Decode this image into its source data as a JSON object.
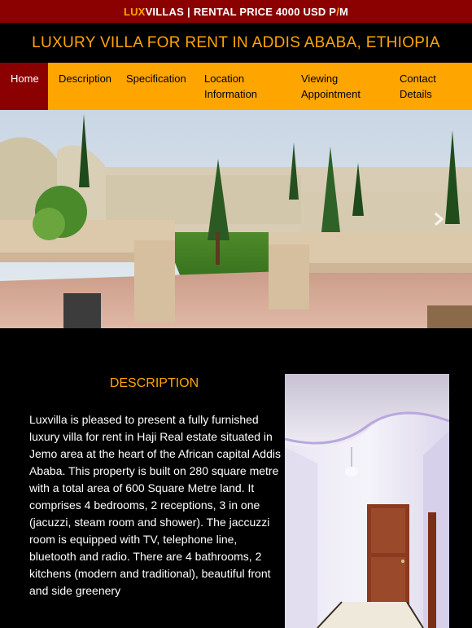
{
  "topbar": {
    "brand_lux": "LUX",
    "brand_villas": "VILLAS",
    "separator": "|",
    "price_main": "RENTAL PRICE 4000 USD P",
    "price_slash": "/",
    "price_m": "M"
  },
  "header": {
    "title": "LUXURY VILLA FOR RENT IN ADDIS ABABA, ETHIOPIA"
  },
  "nav": {
    "items": [
      {
        "line1": "Home",
        "line2": ""
      },
      {
        "line1": "Description",
        "line2": ""
      },
      {
        "line1": "Specification",
        "line2": ""
      },
      {
        "line1": "Location",
        "line2": "Information"
      },
      {
        "line1": "Viewing",
        "line2": "Appointment"
      },
      {
        "line1": "Contact",
        "line2": "Details"
      }
    ]
  },
  "description": {
    "heading": "DESCRIPTION",
    "body": "Luxvilla is pleased to present a fully furnished luxury villa for rent in Haji Real estate situated in Jemo area at the heart of the African capital Addis Ababa. This property is built on 280 square metre with a total area of 600 Square Metre land. It comprises 4 bedrooms, 2 receptions, 3 in one (jacuzzi, steam room and shower). The jaccuzzi room is equipped with TV, telephone line, bluetooth and radio. There are 4 bathrooms, 2 kitchens (modern and traditional), beautiful front and side greenery"
  },
  "colors": {
    "topbar_bg": "#8b0000",
    "accent": "#ffa500",
    "nav_bg": "#ffa500",
    "active_bg": "#8b0000",
    "page_bg": "#000000"
  },
  "icons": {
    "carousel_next": "chevron-right-icon"
  }
}
